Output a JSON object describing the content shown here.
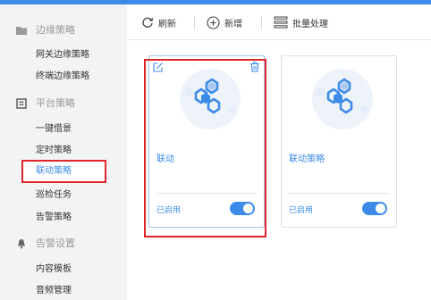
{
  "sidebar": {
    "groups": [
      {
        "label": "边缘策略",
        "icon": "folder-icon",
        "items": [
          "网关边缘策略",
          "终端边缘策略"
        ]
      },
      {
        "label": "平台策略",
        "icon": "document-icon",
        "items": [
          "一键借景",
          "定时策略",
          "联动策略",
          "巡检任务",
          "告警策略"
        ]
      },
      {
        "label": "告警设置",
        "icon": "bell-icon",
        "items": [
          "内容模板",
          "音频管理"
        ]
      }
    ],
    "active_item": "联动策略"
  },
  "toolbar": {
    "refresh_label": "刷新",
    "add_label": "新增",
    "batch_label": "批量处理"
  },
  "cards": [
    {
      "title": "联动",
      "status": "已启用",
      "enabled": true,
      "selected": true
    },
    {
      "title": "联动策略",
      "status": "已启用",
      "enabled": true,
      "selected": false
    }
  ],
  "colors": {
    "accent": "#3d8be8",
    "highlight": "#e0252a",
    "sidebar_bg": "#f2f3f5"
  }
}
